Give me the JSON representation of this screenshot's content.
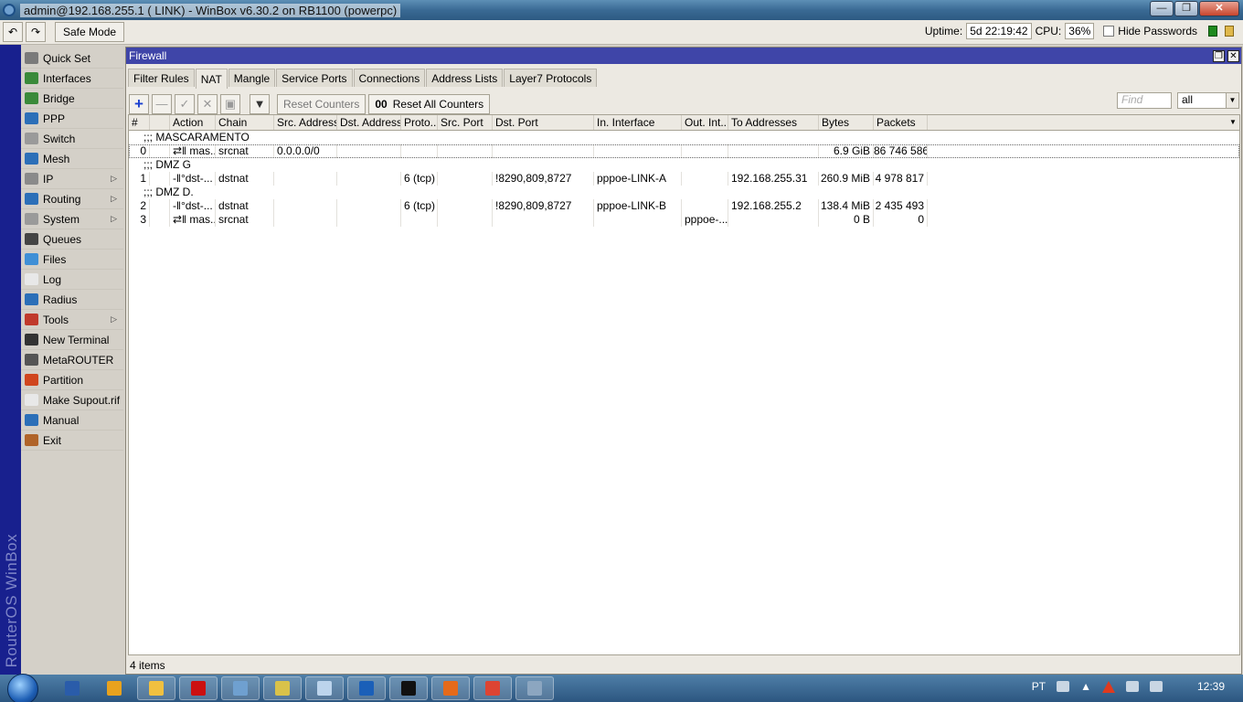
{
  "titlebar": {
    "title": "admin@192.168.255.1 (     LINK) - WinBox v6.30.2 on RB1100 (powerpc)"
  },
  "toolbar": {
    "safe_mode": "Safe Mode",
    "uptime_label": "Uptime:",
    "uptime_value": "5d 22:19:42",
    "cpu_label": "CPU:",
    "cpu_value": "36%",
    "hide_passwords": "Hide Passwords"
  },
  "sidebar": {
    "brand": "RouterOS WinBox",
    "items": [
      {
        "label": "Quick Set",
        "icon": "quick-set-icon",
        "color": "#7a7a7a",
        "submenu": false
      },
      {
        "label": "Interfaces",
        "icon": "interfaces-icon",
        "color": "#3a8a3a",
        "submenu": false
      },
      {
        "label": "Bridge",
        "icon": "bridge-icon",
        "color": "#3a8a3a",
        "submenu": false
      },
      {
        "label": "PPP",
        "icon": "ppp-icon",
        "color": "#2c6fb8",
        "submenu": false
      },
      {
        "label": "Switch",
        "icon": "switch-icon",
        "color": "#9a9a9a",
        "submenu": false
      },
      {
        "label": "Mesh",
        "icon": "mesh-icon",
        "color": "#2c6fb8",
        "submenu": false
      },
      {
        "label": "IP",
        "icon": "ip-icon",
        "color": "#8a8a8a",
        "submenu": true
      },
      {
        "label": "Routing",
        "icon": "routing-icon",
        "color": "#2c6fb8",
        "submenu": true
      },
      {
        "label": "System",
        "icon": "system-icon",
        "color": "#9a9a9a",
        "submenu": true
      },
      {
        "label": "Queues",
        "icon": "queues-icon",
        "color": "#444444",
        "submenu": false
      },
      {
        "label": "Files",
        "icon": "files-icon",
        "color": "#3f8fd6",
        "submenu": false
      },
      {
        "label": "Log",
        "icon": "log-icon",
        "color": "#e8e8e8",
        "submenu": false
      },
      {
        "label": "Radius",
        "icon": "radius-icon",
        "color": "#2c6fb8",
        "submenu": false
      },
      {
        "label": "Tools",
        "icon": "tools-icon",
        "color": "#c0392b",
        "submenu": true
      },
      {
        "label": "New Terminal",
        "icon": "terminal-icon",
        "color": "#333333",
        "submenu": false
      },
      {
        "label": "MetaROUTER",
        "icon": "metarouter-icon",
        "color": "#555555",
        "submenu": false
      },
      {
        "label": "Partition",
        "icon": "partition-icon",
        "color": "#d0461e",
        "submenu": false
      },
      {
        "label": "Make Supout.rif",
        "icon": "supout-icon",
        "color": "#e8e8e8",
        "submenu": false
      },
      {
        "label": "Manual",
        "icon": "manual-icon",
        "color": "#2c6fb8",
        "submenu": false
      },
      {
        "label": "Exit",
        "icon": "exit-icon",
        "color": "#b0642a",
        "submenu": false
      }
    ]
  },
  "firewall": {
    "title": "Firewall",
    "tabs": [
      "Filter Rules",
      "NAT",
      "Mangle",
      "Service Ports",
      "Connections",
      "Address Lists",
      "Layer7 Protocols"
    ],
    "active_tab": "NAT",
    "reset_counters": "Reset Counters",
    "reset_all_counters": "Reset All Counters",
    "reset_all_prefix": "00",
    "find_placeholder": "Find",
    "filter_value": "all",
    "columns": [
      "#",
      "",
      "Action",
      "Chain",
      "Src. Address",
      "Dst. Address",
      "Proto...",
      "Src. Port",
      "Dst. Port",
      "In. Interface",
      "Out. Int...",
      "To Addresses",
      "Bytes",
      "Packets"
    ],
    "rows": [
      {
        "type": "comment",
        "text": ";;; MASCARAMENTO"
      },
      {
        "type": "rule",
        "cells": [
          "0",
          "",
          "⇄‖ mas...",
          "srcnat",
          "0.0.0.0/0",
          "",
          "",
          "",
          "",
          "",
          "",
          "",
          "6.9 GiB",
          "86 746 586"
        ]
      },
      {
        "type": "comment",
        "text": ";;; DMZ G"
      },
      {
        "type": "rule",
        "cells": [
          "1",
          "",
          "-‖°dst-...",
          "dstnat",
          "",
          "",
          "6 (tcp)",
          "",
          "!8290,809,8727",
          "pppoe-LINK-A",
          "",
          "192.168.255.31",
          "260.9 MiB",
          "4 978 817"
        ]
      },
      {
        "type": "comment",
        "text": ";;; DMZ D."
      },
      {
        "type": "rule",
        "cells": [
          "2",
          "",
          "-‖°dst-...",
          "dstnat",
          "",
          "",
          "6 (tcp)",
          "",
          "!8290,809,8727",
          "pppoe-LINK-B",
          "",
          "192.168.255.2",
          "138.4 MiB",
          "2 435 493"
        ]
      },
      {
        "type": "rule",
        "cells": [
          "3",
          "",
          "⇄‖ mas...",
          "srcnat",
          "",
          "",
          "",
          "",
          "",
          "",
          "pppoe-...",
          "",
          "0 B",
          "0"
        ]
      }
    ],
    "status": "4 items"
  },
  "taskbar": {
    "language": "PT",
    "clock": "12:39",
    "apps": [
      {
        "name": "word-icon",
        "color": "#2a5caa"
      },
      {
        "name": "media-player-icon",
        "color": "#e8a21e"
      },
      {
        "name": "explorer-icon",
        "color": "#f0c040"
      },
      {
        "name": "recorder-icon",
        "color": "#cc1010"
      },
      {
        "name": "winbox-icon",
        "color": "#6fa0d0"
      },
      {
        "name": "network-tool-icon",
        "color": "#d9c24a"
      },
      {
        "name": "notepad-icon",
        "color": "#bcd4ec"
      },
      {
        "name": "xmedia-icon",
        "color": "#1a5fb8"
      },
      {
        "name": "cmd-icon",
        "color": "#111111"
      },
      {
        "name": "firefox-icon",
        "color": "#e56a1a"
      },
      {
        "name": "chrome-icon",
        "color": "#dd4433"
      },
      {
        "name": "remote-desktop-icon",
        "color": "#8ca6c0"
      }
    ]
  }
}
